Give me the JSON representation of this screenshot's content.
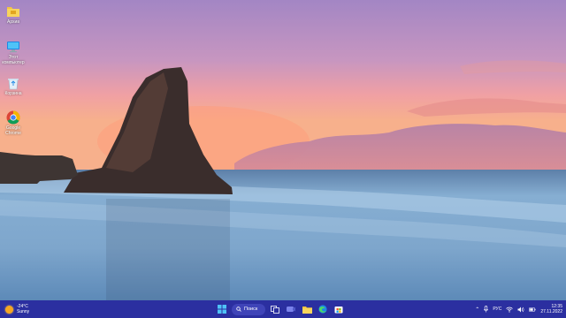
{
  "desktop": {
    "icons": [
      {
        "label": "Архив",
        "icon": "folder-icon"
      },
      {
        "label": "Этот компьютер",
        "icon": "monitor-icon"
      },
      {
        "label": "Корзина",
        "icon": "recycle-bin-icon"
      },
      {
        "label": "Google Chrome",
        "icon": "chrome-icon"
      }
    ]
  },
  "taskbar": {
    "weather": {
      "temp": "-24°C",
      "condition": "Sunny"
    },
    "search_label": "Поиск",
    "apps": [
      "start-icon",
      "search-icon",
      "task-view-icon",
      "chat-icon",
      "file-explorer-icon",
      "edge-icon",
      "store-icon"
    ],
    "tray": {
      "language": "РУС",
      "time": "12:35",
      "date": "27.11.2022"
    }
  },
  "colors": {
    "taskbar_bg": "#2b2fa0",
    "sky_top": "#a884c6",
    "sky_horizon": "#f5a48c",
    "sea": "#7ba3c9"
  }
}
